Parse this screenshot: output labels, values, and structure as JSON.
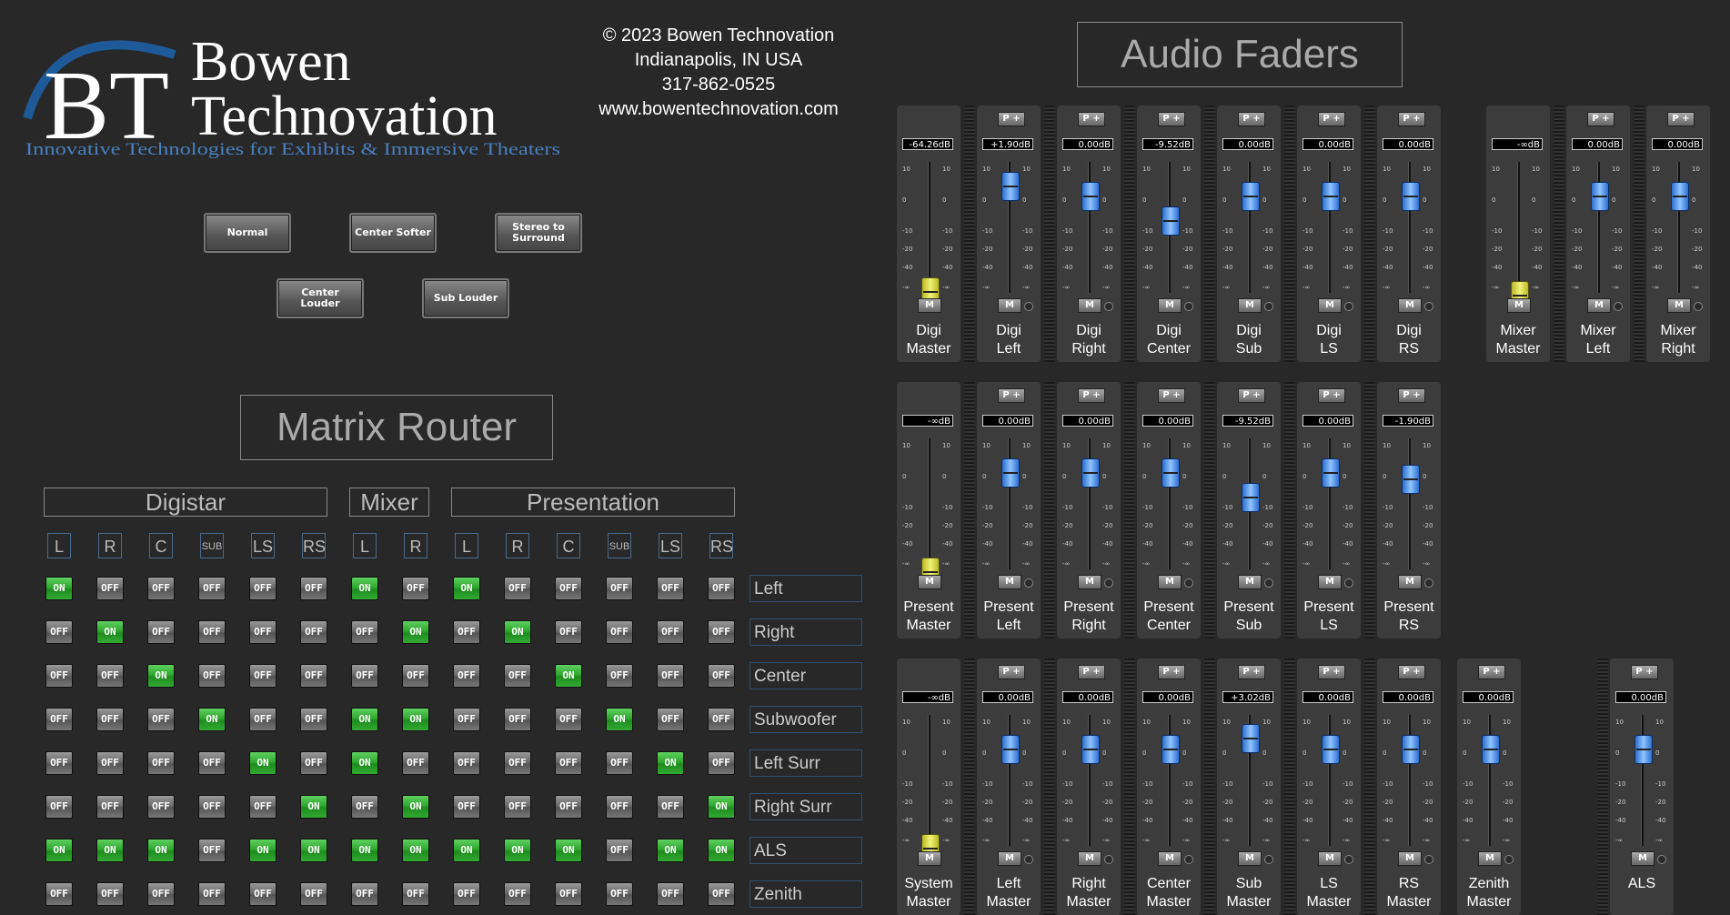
{
  "brand": {
    "initials": "BT",
    "name_line1": "Bowen",
    "name_line2": "Technovation",
    "tagline": "Innovative Technologies for Exhibits & Immersive Theaters"
  },
  "contact": {
    "line1": "© 2023 Bowen Technovation",
    "line2": "Indianapolis, IN USA",
    "line3": "317-862-0525",
    "line4": "www.bowentechnovation.com"
  },
  "presets": {
    "normal": "Normal",
    "center_softer": "Center Softer",
    "stereo_surround": "Stereo to Surround",
    "center_louder": "Center Louder",
    "sub_louder": "Sub Louder"
  },
  "matrix": {
    "title": "Matrix Router",
    "groups": [
      {
        "name": "Digistar",
        "columns": [
          "L",
          "R",
          "C",
          "SUB",
          "LS",
          "RS"
        ]
      },
      {
        "name": "Mixer",
        "columns": [
          "L",
          "R"
        ]
      },
      {
        "name": "Presentation",
        "columns": [
          "L",
          "R",
          "C",
          "SUB",
          "LS",
          "RS"
        ]
      }
    ],
    "on_label": "ON",
    "off_label": "OFF",
    "rows": [
      {
        "label": "Left",
        "state": [
          1,
          0,
          0,
          0,
          0,
          0,
          1,
          0,
          1,
          0,
          0,
          0,
          0,
          0
        ]
      },
      {
        "label": "Right",
        "state": [
          0,
          1,
          0,
          0,
          0,
          0,
          0,
          1,
          0,
          1,
          0,
          0,
          0,
          0
        ]
      },
      {
        "label": "Center",
        "state": [
          0,
          0,
          1,
          0,
          0,
          0,
          0,
          0,
          0,
          0,
          1,
          0,
          0,
          0
        ]
      },
      {
        "label": "Subwoofer",
        "state": [
          0,
          0,
          0,
          1,
          0,
          0,
          1,
          1,
          0,
          0,
          0,
          1,
          0,
          0
        ]
      },
      {
        "label": "Left Surr",
        "state": [
          0,
          0,
          0,
          0,
          1,
          0,
          1,
          0,
          0,
          0,
          0,
          0,
          1,
          0
        ]
      },
      {
        "label": "Right Surr",
        "state": [
          0,
          0,
          0,
          0,
          0,
          1,
          0,
          1,
          0,
          0,
          0,
          0,
          0,
          1
        ]
      },
      {
        "label": "ALS",
        "state": [
          1,
          1,
          1,
          0,
          1,
          1,
          1,
          1,
          1,
          1,
          1,
          0,
          1,
          1
        ]
      },
      {
        "label": "Zenith",
        "state": [
          0,
          0,
          0,
          0,
          0,
          0,
          0,
          0,
          0,
          0,
          0,
          0,
          0,
          0
        ]
      }
    ]
  },
  "faders": {
    "title": "Audio Faders",
    "p_label": "P +",
    "m_label": "M",
    "scale_labels": [
      "10",
      "0",
      "-10",
      "-20",
      "-40",
      "-∞"
    ],
    "rows": [
      [
        {
          "name": "Digi\nMaster",
          "db": "-64.26dB",
          "level": 0.87,
          "master": true
        },
        {
          "name": "Digi\nLeft",
          "db": "+1.90dB",
          "level": 0.1
        },
        {
          "name": "Digi\nRight",
          "db": "0.00dB",
          "level": 0.17
        },
        {
          "name": "Digi\nCenter",
          "db": "-9.52dB",
          "level": 0.35
        },
        {
          "name": "Digi\nSub",
          "db": "0.00dB",
          "level": 0.17
        },
        {
          "name": "Digi\nLS",
          "db": "0.00dB",
          "level": 0.17
        },
        {
          "name": "Digi\nRS",
          "db": "0.00dB",
          "level": 0.17
        },
        {
          "name": "Mixer\nMaster",
          "db": "-∞dB",
          "level": 0.9,
          "master": true
        },
        {
          "name": "Mixer\nLeft",
          "db": "0.00dB",
          "level": 0.17
        },
        {
          "name": "Mixer\nRight",
          "db": "0.00dB",
          "level": 0.17
        }
      ],
      [
        {
          "name": "Present\nMaster",
          "db": "-∞dB",
          "level": 0.9,
          "master": true
        },
        {
          "name": "Present\nLeft",
          "db": "0.00dB",
          "level": 0.17
        },
        {
          "name": "Present\nRight",
          "db": "0.00dB",
          "level": 0.17
        },
        {
          "name": "Present\nCenter",
          "db": "0.00dB",
          "level": 0.17
        },
        {
          "name": "Present\nSub",
          "db": "-9.52dB",
          "level": 0.35
        },
        {
          "name": "Present\nLS",
          "db": "0.00dB",
          "level": 0.17
        },
        {
          "name": "Present\nRS",
          "db": "-1.90dB",
          "level": 0.22
        }
      ],
      [
        {
          "name": "System\nMaster",
          "db": "-∞dB",
          "level": 0.9,
          "master": true
        },
        {
          "name": "Left\nMaster",
          "db": "0.00dB",
          "level": 0.17
        },
        {
          "name": "Right\nMaster",
          "db": "0.00dB",
          "level": 0.17
        },
        {
          "name": "Center\nMaster",
          "db": "0.00dB",
          "level": 0.17
        },
        {
          "name": "Sub\nMaster",
          "db": "+3.02dB",
          "level": 0.09
        },
        {
          "name": "LS\nMaster",
          "db": "0.00dB",
          "level": 0.17
        },
        {
          "name": "RS\nMaster",
          "db": "0.00dB",
          "level": 0.17
        },
        {
          "name": "Zenith\nMaster",
          "db": "0.00dB",
          "level": 0.17
        },
        {
          "name": "ALS",
          "db": "0.00dB",
          "level": 0.17
        }
      ]
    ]
  },
  "colors": {
    "on": "#2fa82f",
    "off": "#6a6a6a",
    "fader_knob": "#5a9cf0",
    "master_knob": "#e0e050",
    "brand_blue": "#1e5a9a"
  }
}
